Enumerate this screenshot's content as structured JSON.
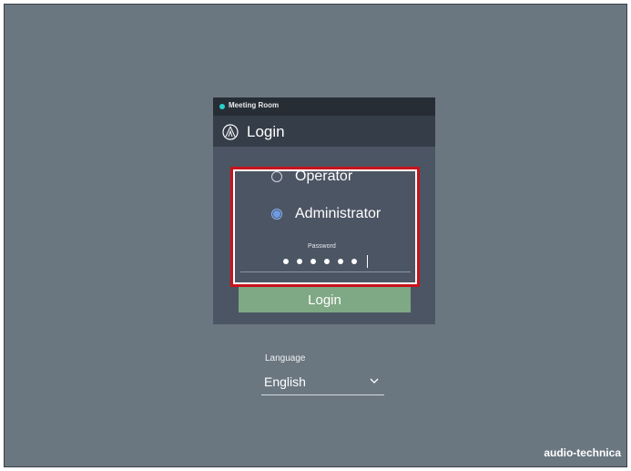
{
  "status_bar": {
    "room_name": "Meeting Room",
    "status_color": "#2ad0cc"
  },
  "header": {
    "title": "Login",
    "logo_icon": "audio-technica-triangle-icon"
  },
  "role_options": [
    {
      "label": "Operator",
      "selected": false
    },
    {
      "label": "Administrator",
      "selected": true
    }
  ],
  "password": {
    "label": "Password",
    "masked_length": 6
  },
  "login_button": {
    "label": "Login",
    "color": "#7fa884"
  },
  "language": {
    "label": "Language",
    "selected": "English",
    "chevron_icon": "chevron-down-icon"
  },
  "brand": {
    "text": "audio-technica"
  },
  "colors": {
    "background": "#6b7780",
    "panel": "#4c5563",
    "highlight": "#c8131c"
  }
}
